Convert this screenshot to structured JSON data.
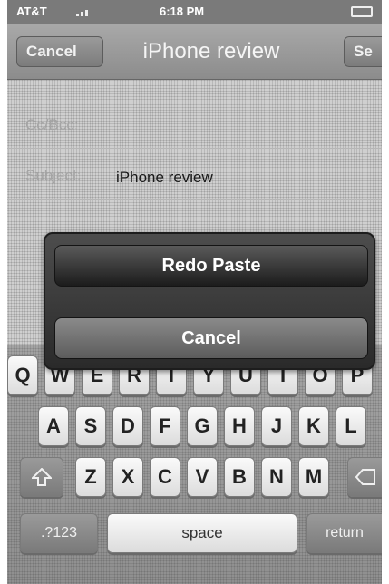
{
  "status_bar": {
    "carrier": "AT&T",
    "time": "6:18 PM"
  },
  "nav": {
    "cancel_label": "Cancel",
    "title": "iPhone review",
    "send_label": "Se"
  },
  "compose": {
    "cc_label": "Cc/Bcc:",
    "subject_label": "Subject:",
    "subject_value": "iPhone review"
  },
  "action_sheet": {
    "redo_label": "Redo Paste",
    "cancel_label": "Cancel"
  },
  "keyboard": {
    "row1": [
      "Q",
      "W",
      "E",
      "R",
      "T",
      "Y",
      "U",
      "I",
      "O",
      "P"
    ],
    "row2": [
      "A",
      "S",
      "D",
      "F",
      "G",
      "H",
      "J",
      "K",
      "L"
    ],
    "row3": [
      "Z",
      "X",
      "C",
      "V",
      "B",
      "N",
      "M"
    ],
    "numbers_label": ".?123",
    "space_label": "space",
    "return_label": "return",
    "shift_icon": "shift-icon",
    "delete_icon": "delete-icon"
  }
}
